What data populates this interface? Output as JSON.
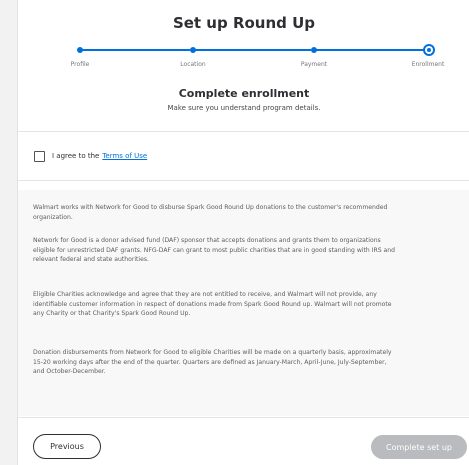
{
  "page": {
    "title": "Set up Round Up"
  },
  "stepper": {
    "steps": [
      {
        "label": "Profile",
        "state": "complete"
      },
      {
        "label": "Location",
        "state": "complete"
      },
      {
        "label": "Payment",
        "state": "complete"
      },
      {
        "label": "Enrollment",
        "state": "current"
      }
    ],
    "accent_color": "#0071dc"
  },
  "enrollment": {
    "heading": "Complete enrollment",
    "subheading": "Make sure you understand program details."
  },
  "agreement": {
    "checkbox_checked": false,
    "label": "I agree to the",
    "link_text": "Terms of Use"
  },
  "terms": {
    "paragraphs": [
      "Walmart works with Network for Good to disburse Spark Good Round Up donations to the customer's recommended organization.",
      "Network for Good is a donor advised fund (DAF) sponsor that accepts donations and grants them to organizations eligible for unrestricted DAF grants. NFG-DAF can grant to most public charities that are in good standing with IRS and relevant federal and state authorities.",
      "Eligible Charities acknowledge and agree that they are not entitled to receive, and Walmart will not provide, any identifiable customer information in respect of donations made from Spark Good Round up. Walmart will not promote any Charity or that Charity's Spark Good Round Up.",
      "Donation disbursements from Network for Good to eligible Charities will be made on a quarterly basis, approximately 15-20 working days after the end of the quarter. Quarters are defined as January-March, April-June, July-September, and October-December."
    ]
  },
  "footer": {
    "previous_label": "Previous",
    "complete_label": "Complete set up",
    "complete_disabled": true
  }
}
